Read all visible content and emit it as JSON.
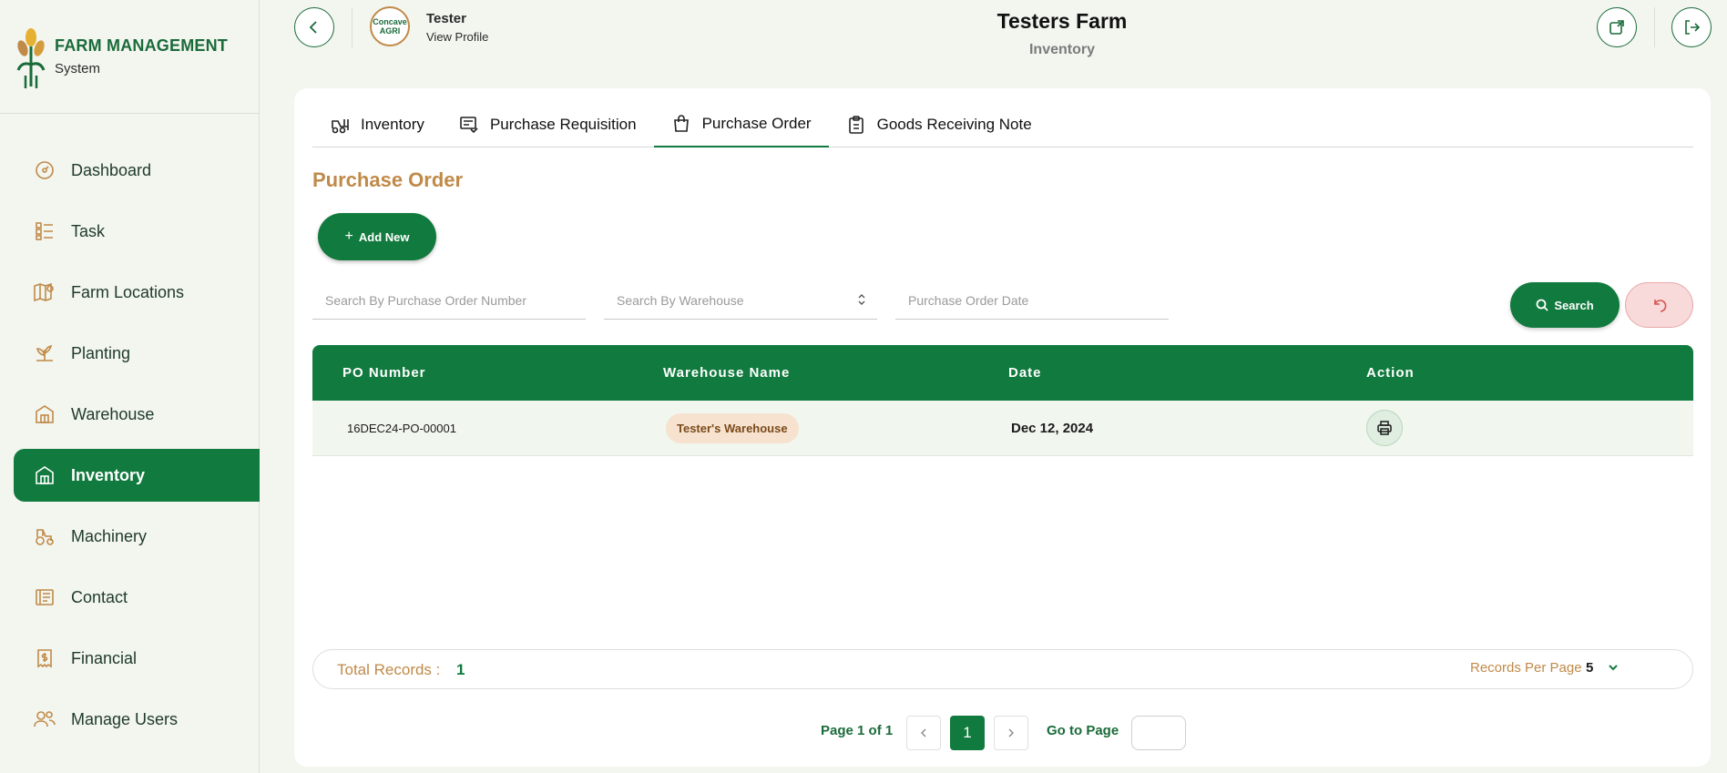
{
  "brand": {
    "title": "FARM MANAGEMENT",
    "subtitle": "System"
  },
  "sidebar": {
    "items": [
      {
        "label": "Dashboard",
        "icon": "dashboard-icon"
      },
      {
        "label": "Task",
        "icon": "task-icon"
      },
      {
        "label": "Farm Locations",
        "icon": "map-pin-icon"
      },
      {
        "label": "Planting",
        "icon": "plant-icon"
      },
      {
        "label": "Warehouse",
        "icon": "warehouse-icon"
      },
      {
        "label": "Inventory",
        "icon": "inventory-icon",
        "active": true
      },
      {
        "label": "Machinery",
        "icon": "tractor-icon"
      },
      {
        "label": "Contact",
        "icon": "contact-icon"
      },
      {
        "label": "Financial",
        "icon": "financial-icon"
      },
      {
        "label": "Manage Users",
        "icon": "users-icon"
      }
    ]
  },
  "header": {
    "user_name": "Tester",
    "profile_link": "View Profile",
    "avatar_text": "Concave AGRI",
    "farm_title": "Testers Farm",
    "section": "Inventory"
  },
  "tabs": [
    {
      "label": "Inventory",
      "icon": "forklift-icon"
    },
    {
      "label": "Purchase Requisition",
      "icon": "requisition-icon"
    },
    {
      "label": "Purchase Order",
      "icon": "shopping-bag-icon",
      "active": true
    },
    {
      "label": "Goods Receiving Note",
      "icon": "clipboard-icon"
    }
  ],
  "page_title": "Purchase Order",
  "add_button": "Add New",
  "filters": {
    "po_number_placeholder": "Search By Purchase Order Number",
    "warehouse_placeholder": "Search By Warehouse",
    "date_placeholder": "Purchase Order Date",
    "search_label": "Search"
  },
  "table": {
    "columns": [
      "PO Number",
      "Warehouse Name",
      "Date",
      "Action"
    ],
    "rows": [
      {
        "po_number": "16DEC24-PO-00001",
        "warehouse": "Tester's Warehouse",
        "date": "Dec 12, 2024"
      }
    ]
  },
  "records": {
    "total_label": "Total Records :",
    "total_value": "1",
    "per_page_label": "Records Per Page",
    "per_page_value": "5"
  },
  "pagination": {
    "page_info": "Page 1 of 1",
    "current_page": "1",
    "goto_label": "Go to Page"
  },
  "colors": {
    "primary": "#117a3e",
    "accent": "#c08a49",
    "background": "#f3f5ef"
  }
}
